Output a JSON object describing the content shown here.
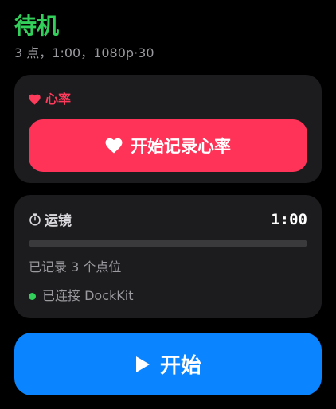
{
  "status": {
    "title": "待机",
    "subtitle": "3 点，1:00，1080p·30"
  },
  "heart_rate": {
    "header_label": "心率",
    "header_icon": "heart-icon",
    "record_button_label": "开始记录心率",
    "record_button_icon": "heart-icon"
  },
  "motion": {
    "title": "运镜",
    "title_icon": "timer-icon",
    "timer_value": "1:00",
    "progress": 0,
    "points_text": "已记录 3 个点位",
    "connection_text": "已连接 DockKit",
    "connection_status": "connected"
  },
  "start": {
    "label": "开始",
    "icon": "play-icon"
  },
  "colors": {
    "status_green": "#32d05a",
    "heart_red": "#ff3b5c",
    "record_button_bg": "#ff3358",
    "start_button_bg": "#0a84ff",
    "card_bg": "#1c1c1e",
    "track_bg": "#3a3a3c"
  }
}
